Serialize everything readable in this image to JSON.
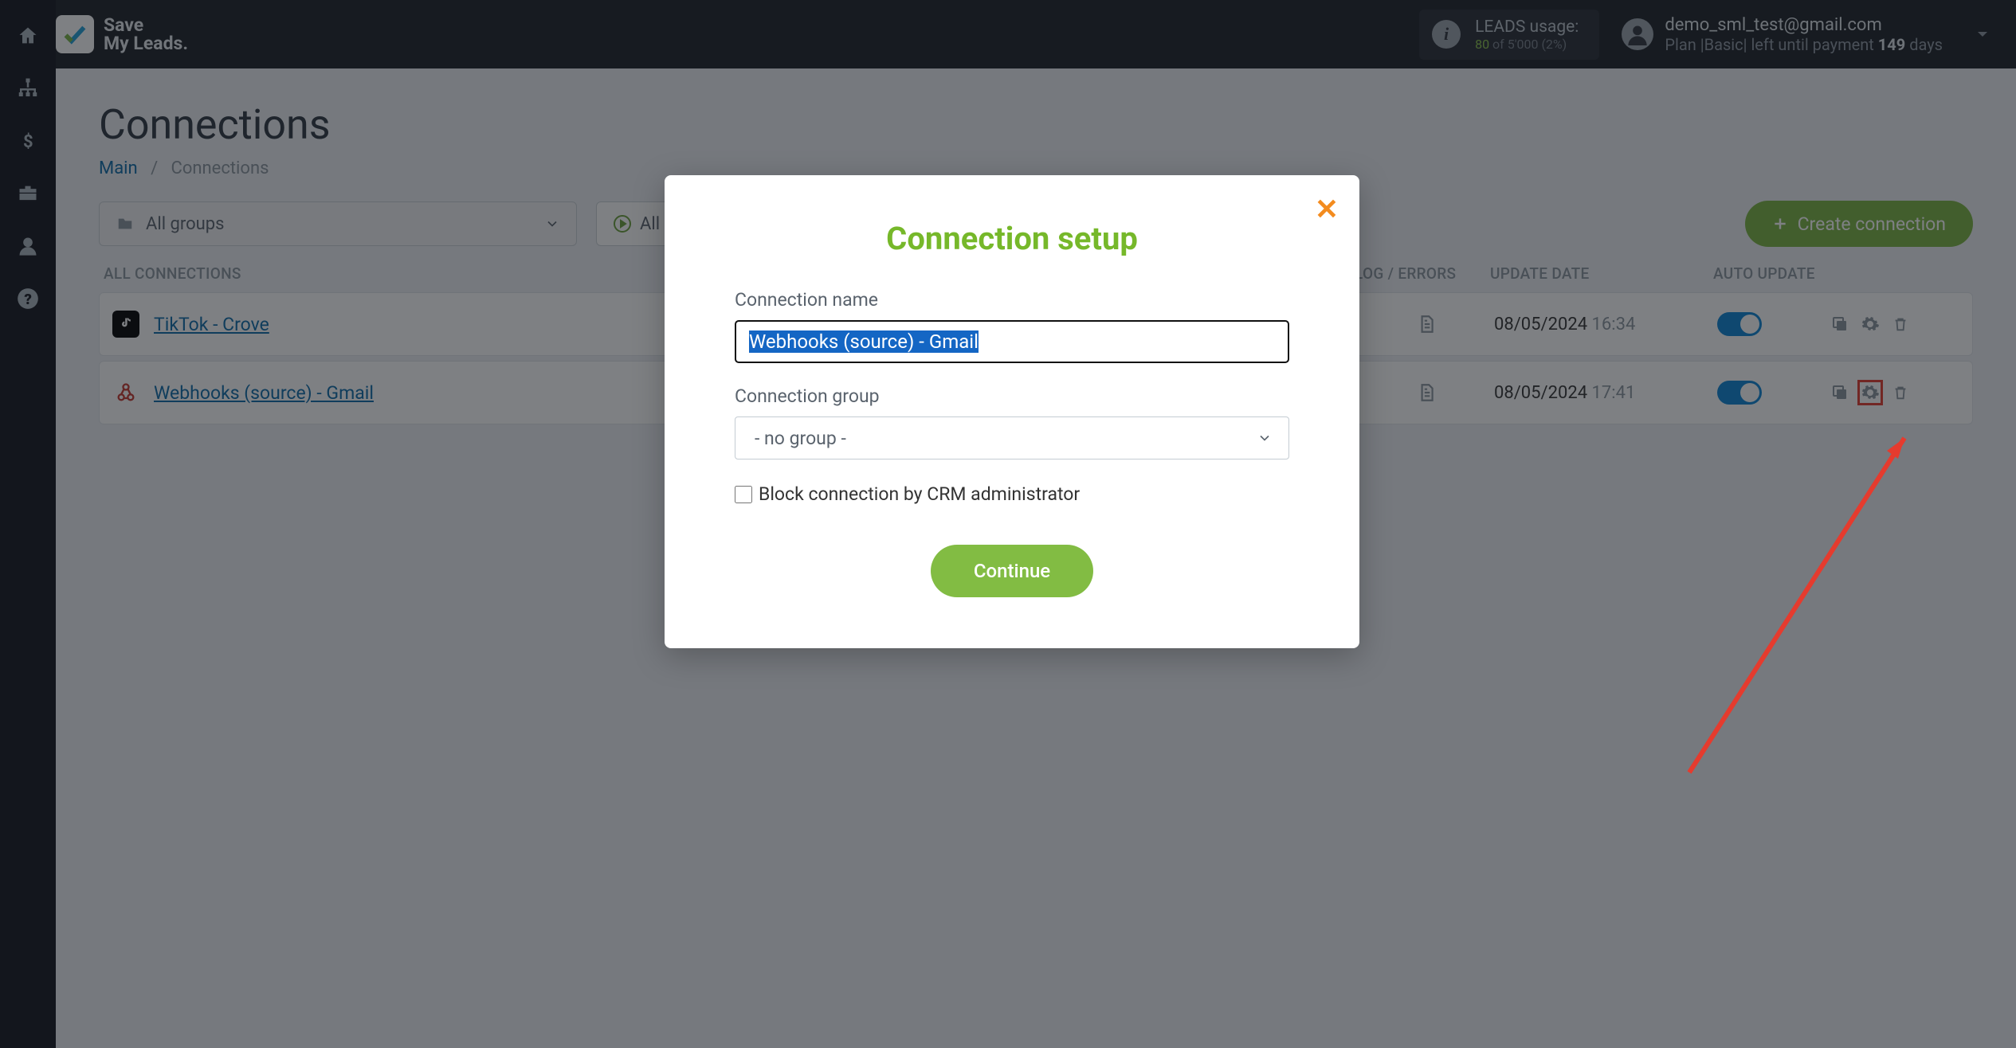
{
  "brand": {
    "line1": "Save",
    "line2": "My Leads."
  },
  "usage": {
    "label": "LEADS usage:",
    "used": "80",
    "of": "of",
    "total": "5'000",
    "pct": "(2%)"
  },
  "account": {
    "email": "demo_sml_test@gmail.com",
    "plan_prefix": "Plan |Basic| left until payment ",
    "days": "149",
    "days_suffix": " days"
  },
  "page": {
    "title": "Connections"
  },
  "breadcrumb": {
    "main": "Main",
    "sep": "/",
    "current": "Connections"
  },
  "filters": {
    "group_label": "All groups",
    "all_on": "All on"
  },
  "buttons": {
    "create": "Create connection",
    "continue": "Continue"
  },
  "table": {
    "head_all": "ALL CONNECTIONS",
    "head_log": "LOG / ERRORS",
    "head_date": "UPDATE DATE",
    "head_auto": "AUTO UPDATE"
  },
  "rows": [
    {
      "name": "TikTok - Crove",
      "date": "08/05/2024",
      "time": "16:34"
    },
    {
      "name": "Webhooks (source) - Gmail",
      "date": "08/05/2024",
      "time": "17:41"
    }
  ],
  "modal": {
    "title": "Connection setup",
    "name_label": "Connection name",
    "name_value": "Webhooks (source) - Gmail",
    "group_label": "Connection group",
    "group_value": "- no group -",
    "block_label": "Block connection by CRM administrator"
  }
}
